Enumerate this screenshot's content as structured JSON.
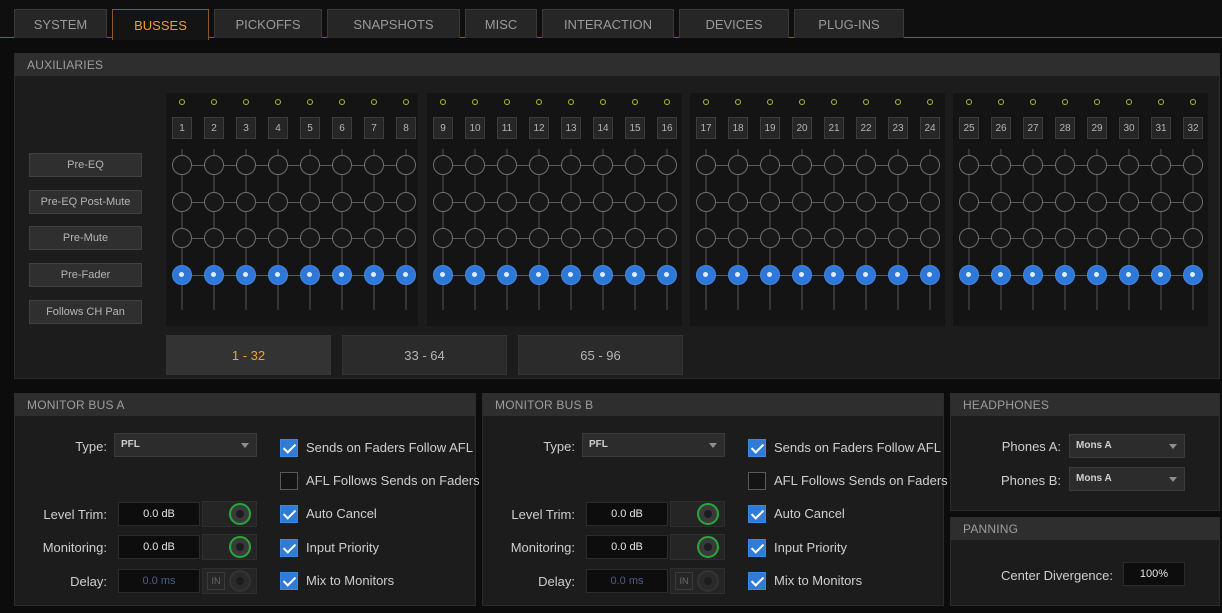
{
  "tabs": [
    {
      "label": "SYSTEM",
      "active": false
    },
    {
      "label": "BUSSES",
      "active": true
    },
    {
      "label": "PICKOFFS",
      "active": false
    },
    {
      "label": "SNAPSHOTS",
      "active": false
    },
    {
      "label": "MISC",
      "active": false
    },
    {
      "label": "INTERACTION",
      "active": false
    },
    {
      "label": "DEVICES",
      "active": false
    },
    {
      "label": "PLUG-INS",
      "active": false
    }
  ],
  "aux": {
    "title": "AUXILIARIES",
    "rows": [
      "Pre-EQ",
      "Pre-EQ Post-Mute",
      "Pre-Mute",
      "Pre-Fader",
      "Follows CH Pan"
    ],
    "selected_row": "Pre-Fader",
    "buses": [
      "1",
      "2",
      "3",
      "4",
      "5",
      "6",
      "7",
      "8",
      "9",
      "10",
      "11",
      "12",
      "13",
      "14",
      "15",
      "16",
      "17",
      "18",
      "19",
      "20",
      "21",
      "22",
      "23",
      "24",
      "25",
      "26",
      "27",
      "28",
      "29",
      "30",
      "31",
      "32"
    ],
    "ranges": [
      "1 - 32",
      "33 - 64",
      "65 - 96"
    ],
    "active_range": "1 - 32"
  },
  "monA": {
    "title": "MONITOR BUS A",
    "type_label": "Type:",
    "type": "PFL",
    "trim_label": "Level Trim:",
    "trim": "0.0 dB",
    "mon_label": "Monitoring:",
    "mon": "0.0 dB",
    "delay_label": "Delay:",
    "delay": "0.0 ms",
    "in": "IN",
    "checks": [
      {
        "label": "Sends on Faders Follow AFL",
        "checked": true
      },
      {
        "label": "AFL Follows Sends on Faders",
        "checked": false
      },
      {
        "label": "Auto Cancel",
        "checked": true
      },
      {
        "label": "Input Priority",
        "checked": true
      },
      {
        "label": "Mix to Monitors",
        "checked": true
      }
    ]
  },
  "monB": {
    "title": "MONITOR BUS B",
    "type_label": "Type:",
    "type": "PFL",
    "trim_label": "Level Trim:",
    "trim": "0.0 dB",
    "mon_label": "Monitoring:",
    "mon": "0.0 dB",
    "delay_label": "Delay:",
    "delay": "0.0 ms",
    "in": "IN",
    "checks": [
      {
        "label": "Sends on Faders Follow AFL",
        "checked": true
      },
      {
        "label": "AFL Follows Sends on Faders",
        "checked": false
      },
      {
        "label": "Auto Cancel",
        "checked": true
      },
      {
        "label": "Input Priority",
        "checked": true
      },
      {
        "label": "Mix to Monitors",
        "checked": true
      }
    ]
  },
  "headphones": {
    "title": "HEADPHONES",
    "a_label": "Phones A:",
    "a": "Mons A",
    "b_label": "Phones B:",
    "b": "Mons A"
  },
  "panning": {
    "title": "PANNING",
    "label": "Center Divergence:",
    "value": "100%"
  },
  "colors": {
    "accent": "#ee9b2f",
    "selected_blue": "#2f78d8",
    "knob_green": "#27a83c"
  }
}
